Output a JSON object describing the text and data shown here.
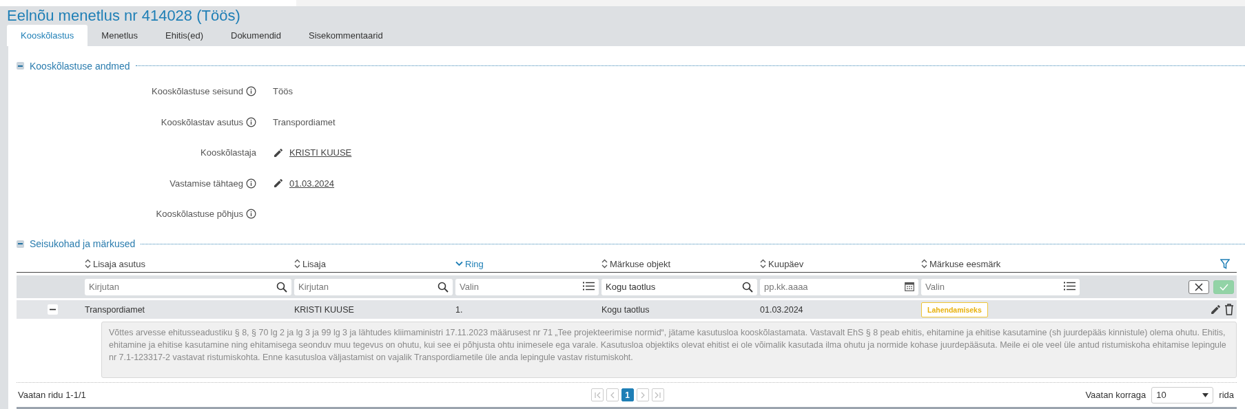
{
  "title": "Eelnõu menetlus nr 414028 (Töös)",
  "tabs": [
    {
      "label": "Kooskõlastus",
      "selected": true
    },
    {
      "label": "Menetlus",
      "selected": false
    },
    {
      "label": "Ehitis(ed)",
      "selected": false
    },
    {
      "label": "Dokumendid",
      "selected": false
    },
    {
      "label": "Sisekommentaarid",
      "selected": false
    }
  ],
  "details": {
    "heading": "Kooskõlastuse andmed",
    "expanded": true,
    "fields": [
      {
        "label": "Kooskõlastuse seisund",
        "info": true,
        "kind": "text",
        "value": "Töös"
      },
      {
        "label": "Kooskõlastav asutus",
        "info": true,
        "kind": "text",
        "value": "Transpordiamet"
      },
      {
        "label": "Kooskõlastaja",
        "info": false,
        "kind": "link",
        "value": "KRISTI KUUSE"
      },
      {
        "label": "Vastamise tähtaeg",
        "info": true,
        "kind": "link",
        "value": "01.03.2024"
      },
      {
        "label": "Kooskõlastuse põhjus",
        "info": true,
        "kind": "empty"
      }
    ]
  },
  "remarks": {
    "heading": "Seisukohad ja märkused",
    "expanded": true,
    "columns": [
      {
        "label": "Lisaja asutus",
        "sorted": false
      },
      {
        "label": "Lisaja",
        "sorted": false
      },
      {
        "label": "Ring",
        "sorted": true
      },
      {
        "label": "Märkuse objekt",
        "sorted": false
      },
      {
        "label": "Kuupäev",
        "sorted": false
      },
      {
        "label": "Märkuse eesmärk",
        "sorted": false
      }
    ],
    "filters": [
      {
        "kind": "search",
        "placeholder": "Kirjutan"
      },
      {
        "kind": "search",
        "placeholder": "Kirjutan"
      },
      {
        "kind": "list",
        "placeholder": "Valin"
      },
      {
        "kind": "search",
        "value": "Kogu taotlus"
      },
      {
        "kind": "date",
        "placeholder": "pp.kk.aaaa"
      },
      {
        "kind": "list",
        "placeholder": "Valin"
      }
    ],
    "rows": [
      {
        "expanded": true,
        "cells": [
          "Transpordiamet",
          "KRISTI KUUSE",
          "1.",
          "Kogu taotlus",
          "01.03.2024"
        ],
        "purpose": "Lahendamiseks",
        "comment": "Võttes arvesse ehitusseadustiku § 8, § 70 lg 2 ja lg 3 ja 99 lg 3 ja lähtudes kliimaministri 17.11.2023 määrusest nr 71 „Tee projekteerimise normid“, jätame kasutusloa kooskõlastamata. Vastavalt EhS § 8 peab ehitis, ehitamine ja ehitise kasutamine (sh juurdepääs kinnistule) olema ohutu. Ehitis, ehitamine ja ehitise kasutamine ning ehitamisega seonduv muu tegevus on ohutu, kui see ei põhjusta ohtu inimesele ega varale. Kasutusloa objektiks olevat ehitist ei ole võimalik kasutada ilma ohutu ja normide kohase juurdepääsuta. Meile ei ole veel üle antud ristumiskoha ehitamise lepingule nr 7.1-123317-2 vastavat ristumiskohta. Enne kasutusloa väljastamist on vajalik Transpordiametile üle anda lepingule vastav ristumiskoht."
      }
    ],
    "footer": {
      "range": "Vaatan ridu 1-1/1",
      "pages": [
        {
          "kind": "first",
          "disabled": true
        },
        {
          "kind": "prev",
          "disabled": true
        },
        {
          "kind": "page",
          "label": "1",
          "selected": true
        },
        {
          "kind": "next",
          "disabled": true
        },
        {
          "kind": "last",
          "disabled": true
        }
      ],
      "page_size_label": "Vaatan korraga",
      "page_size": "10",
      "rows_label": "rida"
    }
  }
}
